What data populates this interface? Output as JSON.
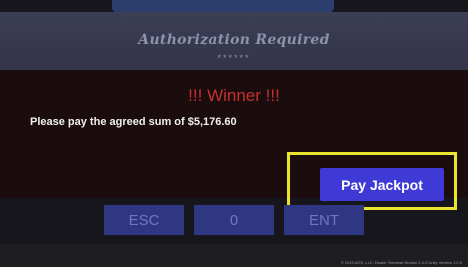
{
  "dialog": {
    "title": "Authorization Required",
    "masked_code": "******"
  },
  "content": {
    "heading": "!!! Winner !!!",
    "message": "Please pay the agreed sum of $5,176.60"
  },
  "actions": {
    "pay_label": "Pay Jackpot"
  },
  "keypad": {
    "esc_label": "ESC",
    "zero_label": "0",
    "ent_label": "ENT"
  },
  "footer": {
    "copyright": "© 2015 AGS, LLC. Dealer Terminal Version 1.0.0  Unity Version 1.0.0"
  },
  "colors": {
    "highlight_border": "#e9e52e",
    "pay_button": "#3f3ad6",
    "winner_text": "#c62f2f"
  }
}
